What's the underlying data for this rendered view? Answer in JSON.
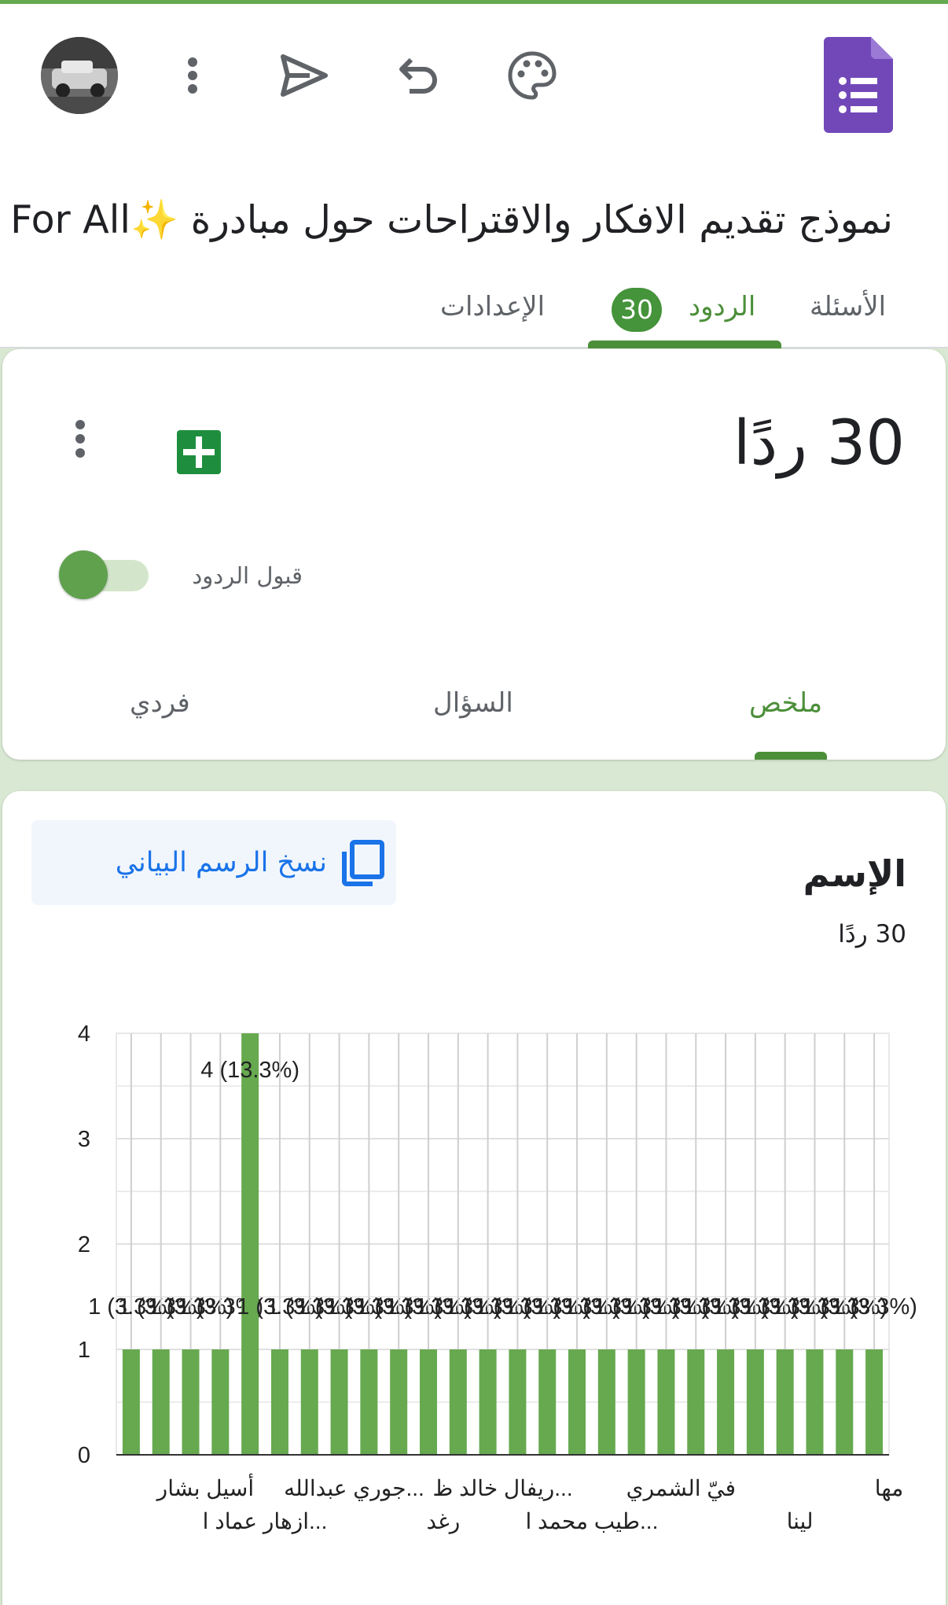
{
  "header": {
    "avatar_alt": "avatar",
    "form_title": "نموذج تقديم الافكار والاقتراحات حول مبادرة ✨For All ✨",
    "icons": [
      "more-vert-icon",
      "send-icon",
      "undo-icon",
      "palette-icon",
      "forms-logo-icon"
    ]
  },
  "tabs": {
    "questions": "الأسئلة",
    "responses": "الردود",
    "responses_count": "30",
    "settings": "الإعدادات"
  },
  "summary": {
    "title": "30 ردًا",
    "accepting_label": "قبول الردود",
    "accepting": true,
    "subtabs": {
      "summary": "ملخص",
      "question": "السؤال",
      "individual": "فردي"
    }
  },
  "question_card": {
    "copy_chart": "نسخ الرسم البياني",
    "title": "الإسم",
    "count": "30 ردًا"
  },
  "chart_data": {
    "type": "bar",
    "color": "#66a94f",
    "yticks": [
      "0",
      "1",
      "2",
      "3",
      "4"
    ],
    "ylim": [
      0,
      4
    ],
    "grid": true,
    "values": [
      1,
      1,
      1,
      1,
      4,
      1,
      1,
      1,
      1,
      1,
      1,
      1,
      1,
      1,
      1,
      1,
      1,
      1,
      1,
      1,
      1,
      1,
      1,
      1,
      1,
      1
    ],
    "data_labels": [
      "1 (3.3%)",
      "1 (3.3%)",
      "1 (3.3%)",
      "1 (3.3%)",
      "4 (13.3%)",
      "1 (3.3%)",
      "1 (3.3%)",
      "1 (3.3%)",
      "1 (3.3%)",
      "1 (3.3%)",
      "1 (3.3%)",
      "1 (3.3%)",
      "1 (3.3%)",
      "1 (3.3%)",
      "1 (3.3%)",
      "1 (3.3%)",
      "1 (3.3%)",
      "1 (3.3%)",
      "1 (3.3%)",
      "1 (3.3%)",
      "1 (3.3%)",
      "1 (3.3%)",
      "1 (3.3%)",
      "1 (3.3%)",
      "1 (3.3%)",
      "1 (3.3%)"
    ],
    "category_labels": [
      {
        "text": "أسيل بشار",
        "row": 1,
        "after_bar": 2
      },
      {
        "text": "جوري عبدالله...",
        "row": 1,
        "after_bar": 7
      },
      {
        "text": "ريفال خالد ظ...",
        "row": 1,
        "after_bar": 12
      },
      {
        "text": "فيّ الشمري",
        "row": 1,
        "after_bar": 18
      },
      {
        "text": "مها",
        "row": 1,
        "after_bar": 25
      },
      {
        "text": "ازهار عماد ا...",
        "row": 2,
        "after_bar": 4
      },
      {
        "text": "رغد",
        "row": 2,
        "after_bar": 10
      },
      {
        "text": "طيب محمد ا...",
        "row": 2,
        "after_bar": 15
      },
      {
        "text": "لينا",
        "row": 2,
        "after_bar": 22
      }
    ]
  }
}
